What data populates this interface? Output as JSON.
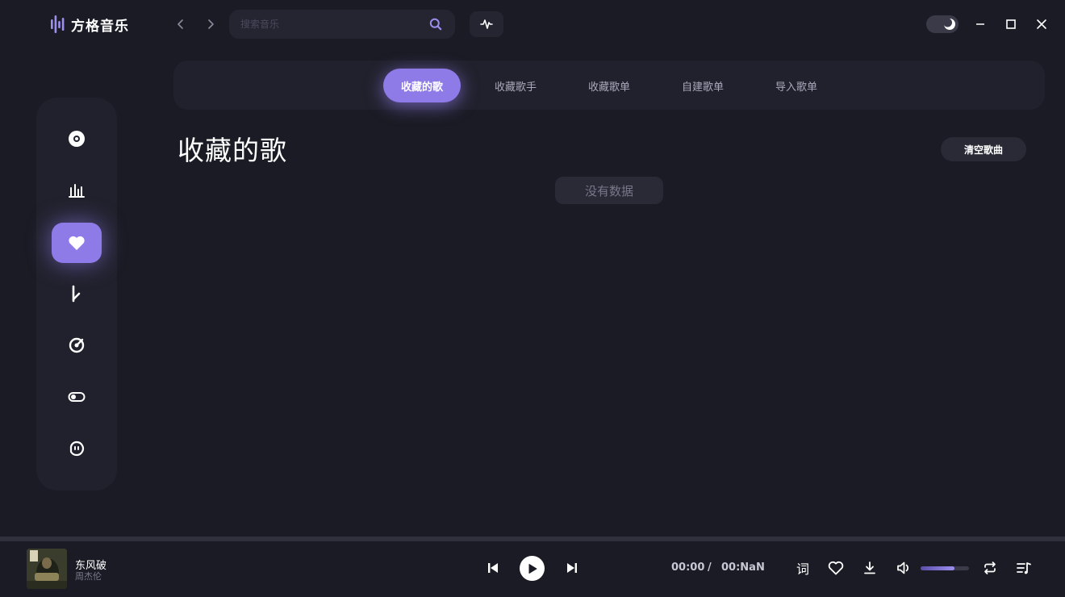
{
  "app": {
    "name": "方格音乐"
  },
  "search": {
    "placeholder": "搜索音乐"
  },
  "sidebar": {
    "items": [
      {
        "icon": "disc-icon"
      },
      {
        "icon": "bar-chart-icon"
      },
      {
        "icon": "heart-icon",
        "active": true
      },
      {
        "icon": "music-note-icon"
      },
      {
        "icon": "radar-icon"
      },
      {
        "icon": "toggle-icon"
      },
      {
        "icon": "face-icon"
      }
    ]
  },
  "tabs": [
    {
      "label": "收藏的歌",
      "active": true
    },
    {
      "label": "收藏歌手"
    },
    {
      "label": "收藏歌单"
    },
    {
      "label": "自建歌单"
    },
    {
      "label": "导入歌单"
    }
  ],
  "page": {
    "title": "收藏的歌",
    "clear_label": "清空歌曲",
    "empty_text": "没有数据"
  },
  "player": {
    "song_title": "东风破",
    "artist": "周杰伦",
    "current_time": "00:00",
    "separator": "/",
    "total_time": "00:NaN",
    "lyric_label": "词",
    "volume": 0.7,
    "progress": 0
  },
  "colors": {
    "accent": "#8e7be8",
    "background": "#1b1b25",
    "panel": "#21212d"
  }
}
